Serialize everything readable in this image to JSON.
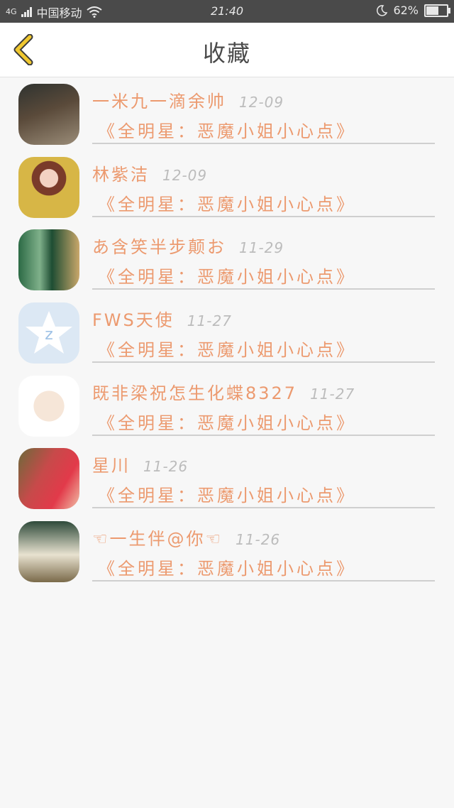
{
  "status_bar": {
    "network": "4G",
    "carrier": "中国移动",
    "time": "21:40",
    "battery": "62%",
    "battery_level": 0.62
  },
  "header": {
    "title": "收藏",
    "back_icon": "chevron-left-icon",
    "accent": "#f0c830"
  },
  "colors": {
    "name": "#ec9a6f",
    "date": "#bcbcbc",
    "background": "#f7f7f7"
  },
  "favorites": [
    {
      "name": "一米九一滴余帅",
      "date": "12-09",
      "title": "《全明星：恶魔小姐小心点》"
    },
    {
      "name": "林紫洁",
      "date": "12-09",
      "title": "《全明星：恶魔小姐小心点》"
    },
    {
      "name": "あ含笑半步颠お",
      "date": "11-29",
      "title": "《全明星：恶魔小姐小心点》"
    },
    {
      "name": "FWS天使",
      "date": "11-27",
      "title": "《全明星：恶魔小姐小心点》"
    },
    {
      "name": "既非梁祝怎生化蝶8327",
      "date": "11-27",
      "title": "《全明星：恶魔小姐小心点》"
    },
    {
      "name": "星川",
      "date": "11-26",
      "title": "《全明星：恶魔小姐小心点》"
    },
    {
      "name": "☜一生伴@你☜",
      "date": "11-26",
      "title": "《全明星：恶魔小姐小心点》"
    }
  ]
}
